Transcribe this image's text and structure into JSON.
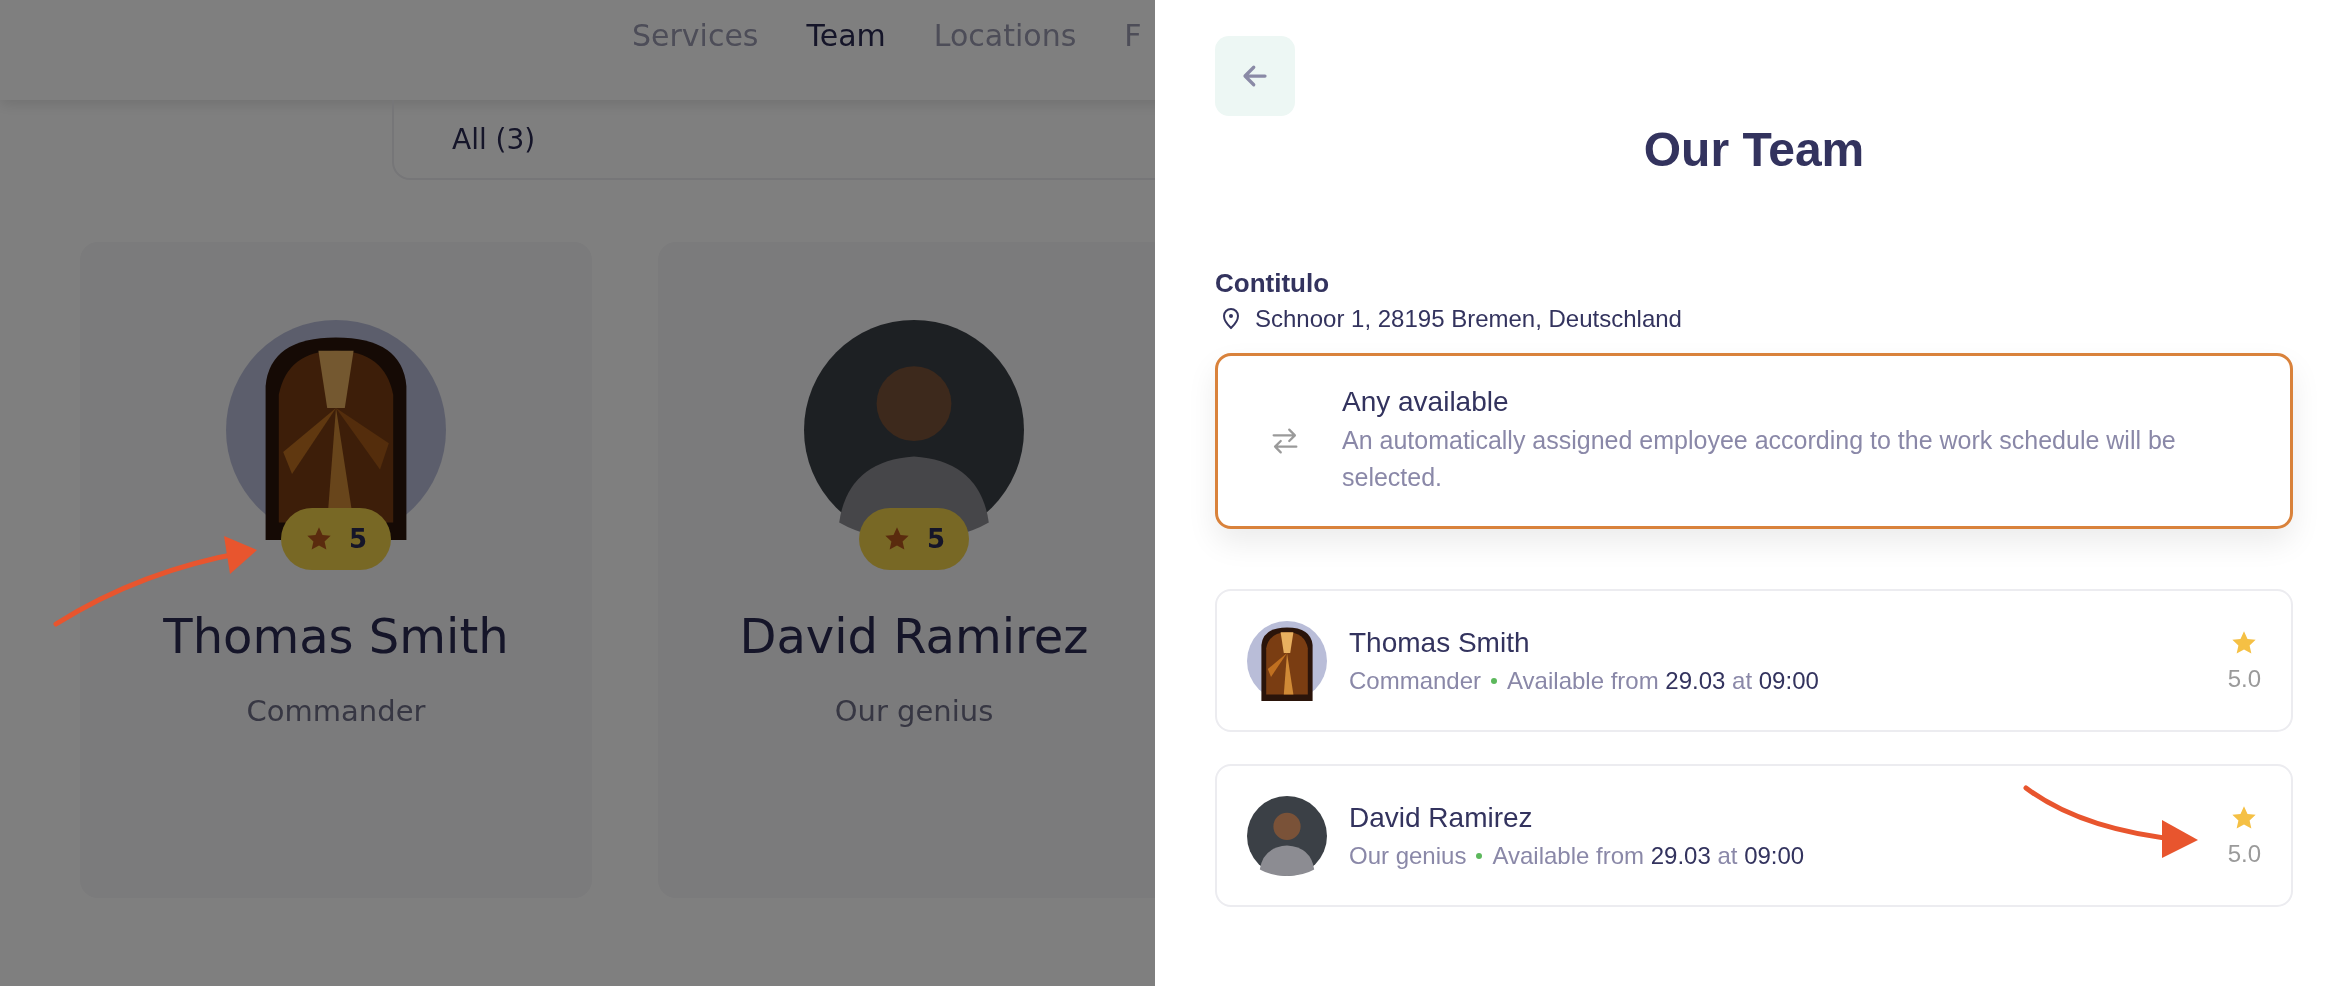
{
  "nav": {
    "items": [
      {
        "label": "Services",
        "selected": false
      },
      {
        "label": "Team",
        "selected": true
      },
      {
        "label": "Locations",
        "selected": false
      },
      {
        "label": "F",
        "selected": false
      }
    ]
  },
  "filter": {
    "label": "All (3)"
  },
  "team_cards": [
    {
      "name": "Thomas Smith",
      "role": "Commander",
      "rating": "5",
      "kind": "picture"
    },
    {
      "name": "David Ramirez",
      "role": "Our genius",
      "rating": "5",
      "kind": "person"
    }
  ],
  "drawer": {
    "title": "Our Team",
    "location": {
      "name": "Contitulo",
      "address": "Schnoor 1, 28195 Bremen, Deutschland"
    },
    "any_available": {
      "title": "Any available",
      "description": "An automatically assigned employee according to the work schedule will be selected.",
      "selected": true
    },
    "employees": [
      {
        "name": "Thomas Smith",
        "role": "Commander",
        "availability": "Available from **29.03** at **09:00**",
        "rating": "5.0",
        "kind": "picture"
      },
      {
        "name": "David Ramirez",
        "role": "Our genius",
        "availability": "Available from **29.03** at **09:00**",
        "rating": "5.0",
        "kind": "person"
      }
    ]
  }
}
